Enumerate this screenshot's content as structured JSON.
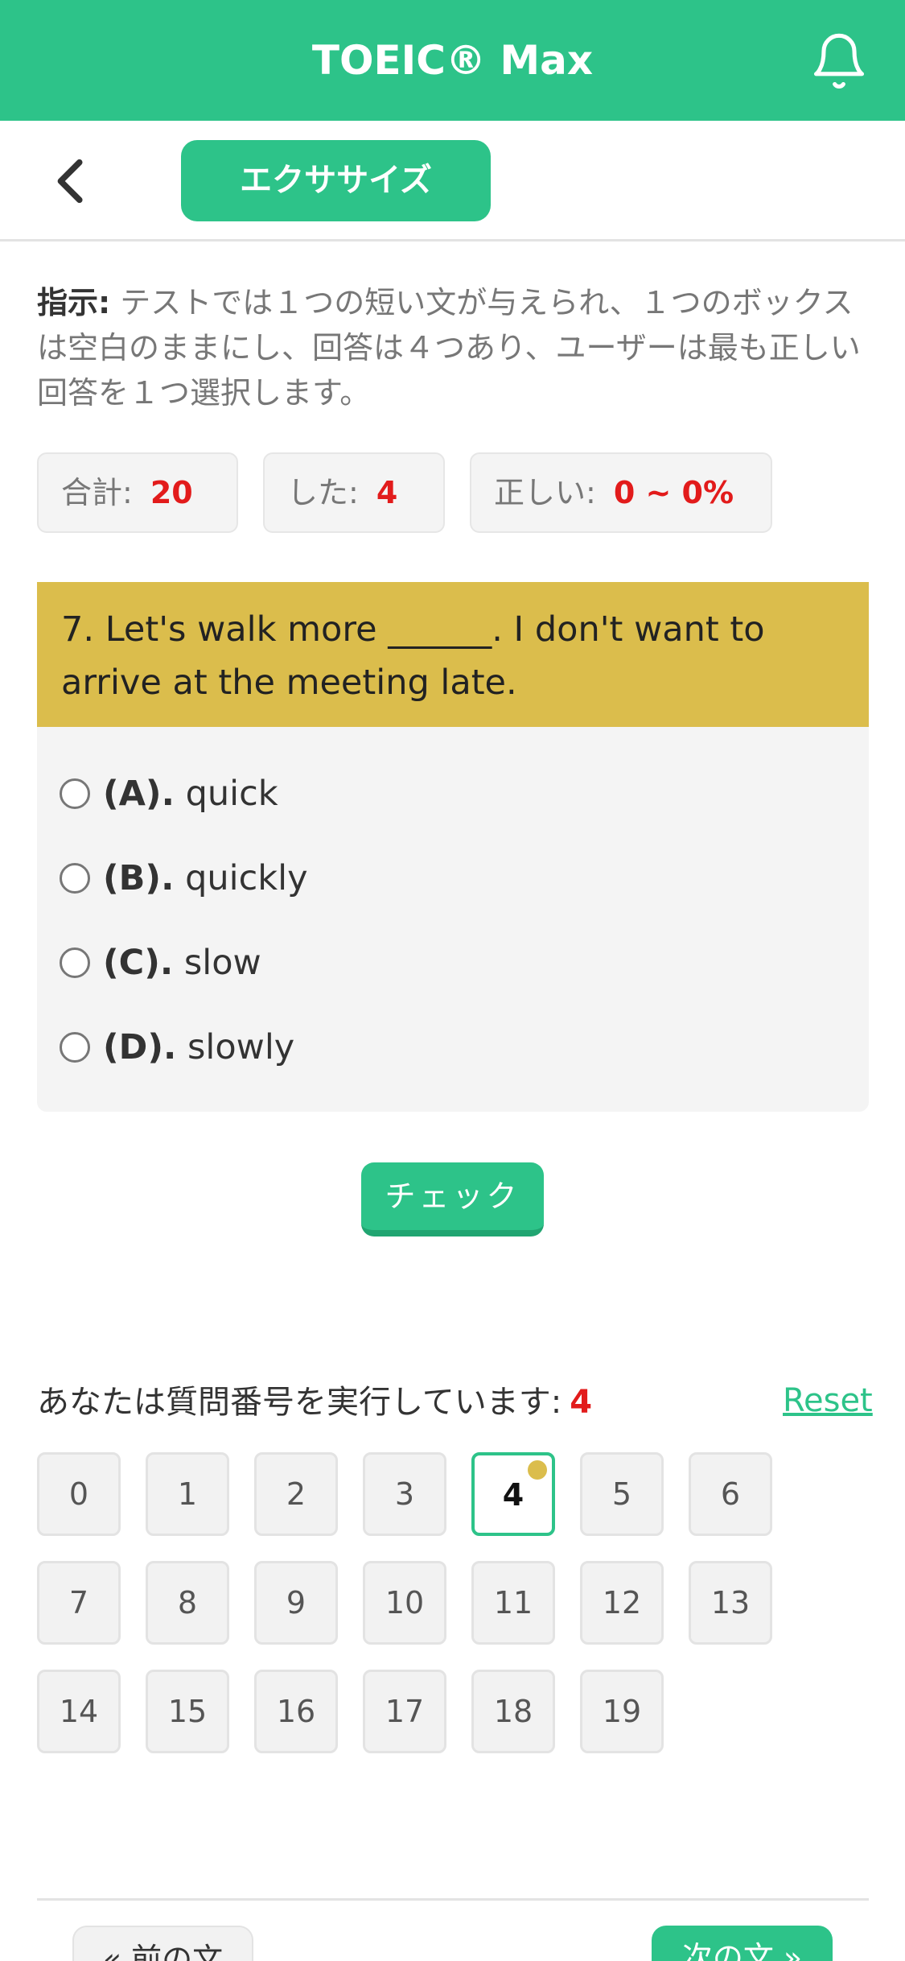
{
  "header": {
    "title": "TOEIC® Max",
    "bell_icon": "bell-icon"
  },
  "subbar": {
    "back_icon": "chevron-left-icon",
    "exercise_label": "エクササイズ"
  },
  "instructions": {
    "label": "指示:",
    "text": " テストでは１つの短い文が与えられ、１つのボックスは空白のままにし、回答は４つあり、ユーザーは最も正しい回答を１つ選択します。"
  },
  "stats": {
    "total_label": "合計:",
    "total_value": "20",
    "done_label": "した:",
    "done_value": "4",
    "correct_label": "正しい:",
    "correct_value": "0 ~ 0%"
  },
  "question": {
    "text": "7. Let's walk more ______. I don't want to arrive at the meeting late."
  },
  "options": [
    {
      "letter": "(A).",
      "text": "quick"
    },
    {
      "letter": "(B).",
      "text": "quickly"
    },
    {
      "letter": "(C).",
      "text": "slow"
    },
    {
      "letter": "(D).",
      "text": "slowly"
    }
  ],
  "check_label": "チェック",
  "progress": {
    "label": "あなたは質問番号を実行しています:",
    "current": "4",
    "reset_label": "Reset"
  },
  "numbers": [
    "0",
    "1",
    "2",
    "3",
    "4",
    "5",
    "6",
    "7",
    "8",
    "9",
    "10",
    "11",
    "12",
    "13",
    "14",
    "15",
    "16",
    "17",
    "18",
    "19"
  ],
  "nav": {
    "prev_label": "« 前の文",
    "next_label": "次の文 »"
  },
  "colors": {
    "accent": "#2dc389",
    "question_bg": "#dbbd4c",
    "highlight": "#e21b1b"
  }
}
